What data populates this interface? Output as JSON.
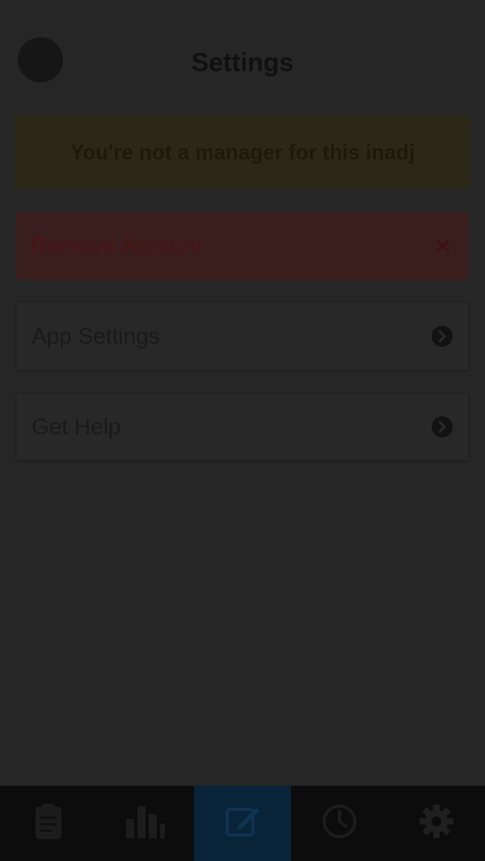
{
  "header": {
    "title": "Settings"
  },
  "warning": {
    "text": "You're not a manager for this inadj"
  },
  "menu": {
    "remove_account": {
      "label": "Remove Account",
      "icon": "close-icon"
    },
    "app_settings": {
      "label": "App Settings",
      "icon": "chevron-right-icon"
    },
    "get_help": {
      "label": "Get Help",
      "icon": "chevron-right-icon"
    }
  },
  "navbar": {
    "items": [
      {
        "name": "clipboard",
        "icon": "clipboard-icon",
        "active": false
      },
      {
        "name": "reports",
        "icon": "bar-chart-icon",
        "active": false
      },
      {
        "name": "edit",
        "icon": "edit-icon",
        "active": true
      },
      {
        "name": "history",
        "icon": "clock-icon",
        "active": false
      },
      {
        "name": "settings",
        "icon": "gear-icon",
        "active": false
      }
    ]
  },
  "colors": {
    "accent": "#092338",
    "danger_bg": "#3a1e1e",
    "warning_bg": "#2b2818"
  }
}
